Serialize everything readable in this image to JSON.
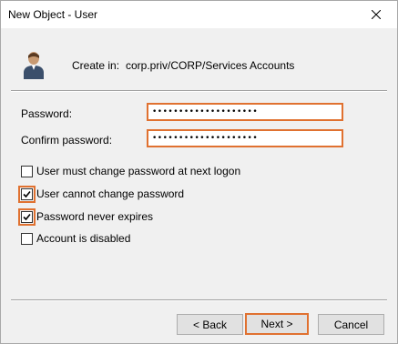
{
  "window": {
    "title": "New Object - User"
  },
  "header": {
    "create_in_label": "Create in:",
    "create_in_path": "corp.priv/CORP/Services Accounts"
  },
  "fields": {
    "password_label": "Password:",
    "password_value": "••••••••••••••••••••",
    "confirm_label": "Confirm password:",
    "confirm_value": "••••••••••••••••••••"
  },
  "checkboxes": [
    {
      "label": "User must change password at next logon",
      "checked": false
    },
    {
      "label": "User cannot change password",
      "checked": true
    },
    {
      "label": "Password never expires",
      "checked": true
    },
    {
      "label": "Account is disabled",
      "checked": false
    }
  ],
  "buttons": {
    "back": "< Back",
    "next": "Next >",
    "cancel": "Cancel"
  },
  "colors": {
    "highlight": "#e07130",
    "window_bg": "#f0f0f0",
    "button_bg": "#e1e1e1"
  }
}
